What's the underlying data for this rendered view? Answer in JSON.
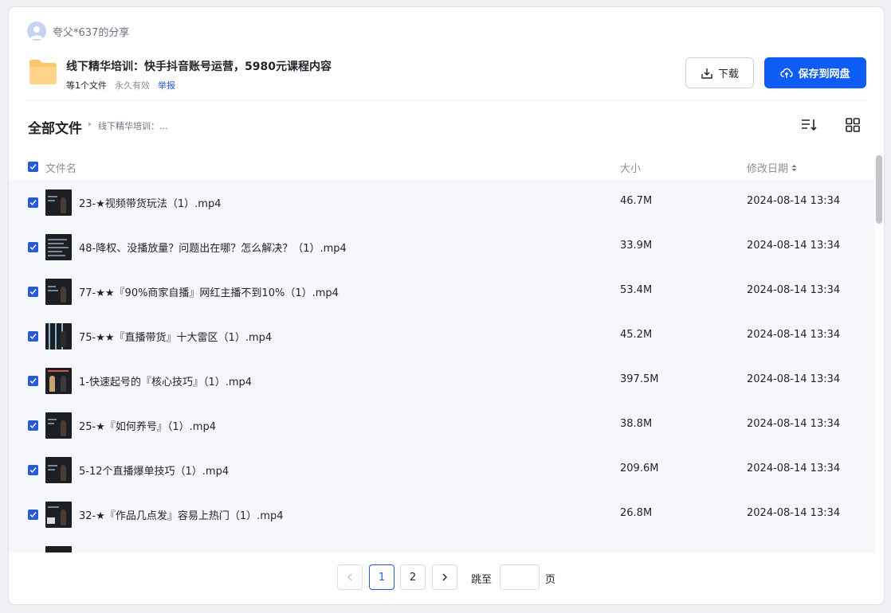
{
  "sharer": {
    "name": "夸父*637的分享"
  },
  "share": {
    "title": "线下精华培训：快手抖音账号运营，5980元课程内容",
    "count": "等1个文件",
    "validity": "永久有效",
    "report": "举报"
  },
  "actions": {
    "download": "下载",
    "save": "保存到网盘"
  },
  "breadcrumb": {
    "root": "全部文件",
    "current": "线下精华培训：..."
  },
  "columns": {
    "name": "文件名",
    "size": "大小",
    "date": "修改日期"
  },
  "files": [
    {
      "name": "23-★视频带货玩法（1）.mp4",
      "size": "46.7M",
      "date": "2024-08-14 13:34"
    },
    {
      "name": "48-降权、没播放量？问题出在哪？怎么解决？（1）.mp4",
      "size": "33.9M",
      "date": "2024-08-14 13:34"
    },
    {
      "name": "77-★★『90%商家自播』网红主播不到10%（1）.mp4",
      "size": "53.4M",
      "date": "2024-08-14 13:34"
    },
    {
      "name": "75-★★『直播带货』十大雷区（1）.mp4",
      "size": "45.2M",
      "date": "2024-08-14 13:34"
    },
    {
      "name": "1-快速起号的『核心技巧』（1）.mp4",
      "size": "397.5M",
      "date": "2024-08-14 13:34"
    },
    {
      "name": "25-★『如何养号』（1）.mp4",
      "size": "38.8M",
      "date": "2024-08-14 13:34"
    },
    {
      "name": "5-12个直播爆单技巧（1）.mp4",
      "size": "209.6M",
      "date": "2024-08-14 13:34"
    },
    {
      "name": "32-★『作品几点发』容易上热门（1）.mp4",
      "size": "26.8M",
      "date": "2024-08-14 13:34"
    },
    {
      "name": "",
      "size": "",
      "date": ""
    }
  ],
  "pagination": {
    "pages": [
      "1",
      "2"
    ],
    "current": "1",
    "jump_label": "跳至",
    "page_unit": "页"
  },
  "colors": {
    "primary": "#0d5cf5",
    "link": "#2459d8",
    "row_bg": "#f5f7fb"
  },
  "icons": [
    "user-icon",
    "folder-icon",
    "download-icon",
    "cloud-upload-icon",
    "sort-icon",
    "grid-view-icon",
    "checkbox-checked-icon",
    "sort-arrows-icon",
    "chevron-left-icon",
    "chevron-right-icon"
  ]
}
